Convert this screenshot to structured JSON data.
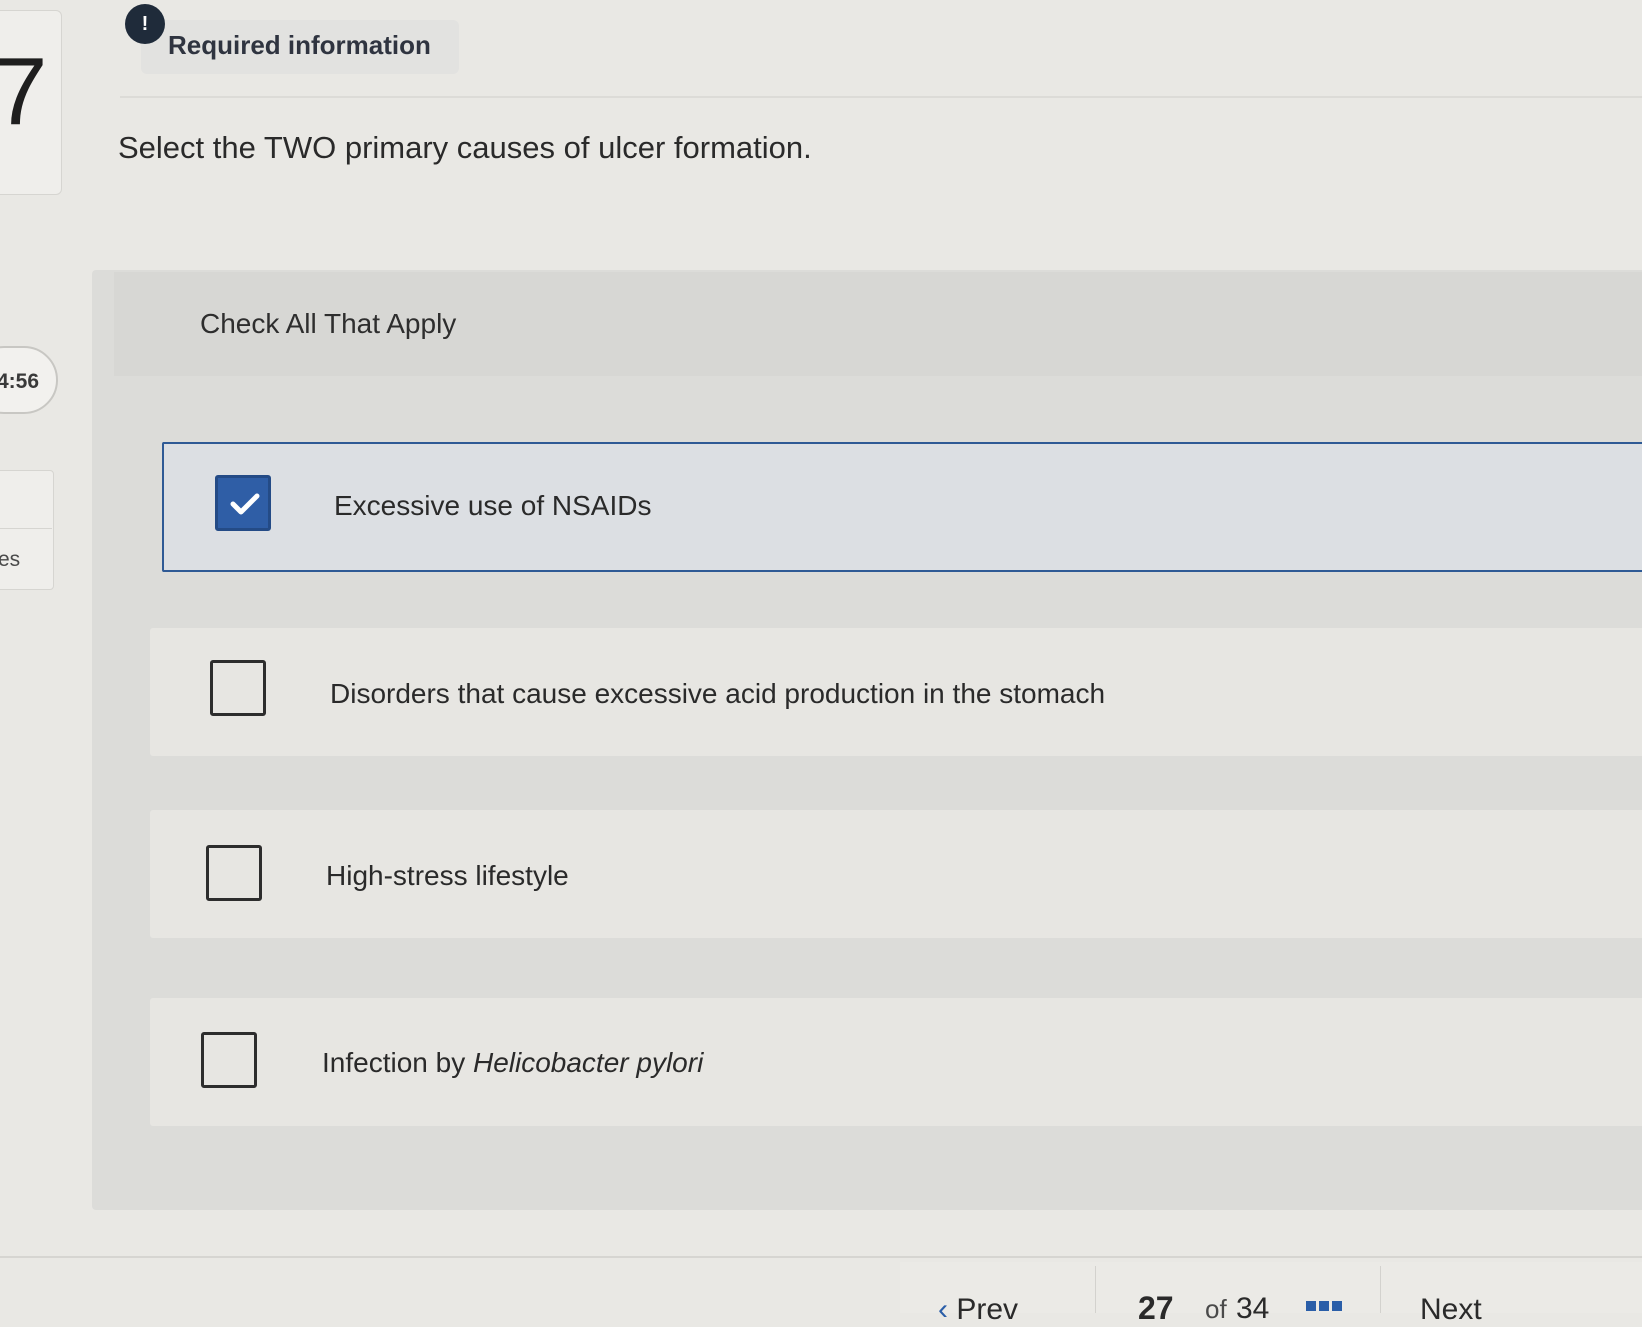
{
  "question": {
    "number": "7",
    "required_label": "Required information",
    "alert_icon": "exclamation",
    "prompt": "Select the TWO primary causes of ulcer formation.",
    "instruction": "Check All That Apply"
  },
  "sidebar": {
    "timer": "4:56",
    "partial_label": "es"
  },
  "options": [
    {
      "label": "Excessive use of NSAIDs",
      "checked": true
    },
    {
      "label": "Disorders that cause excessive acid production in the stomach",
      "checked": false
    },
    {
      "label": "High-stress lifestyle",
      "checked": false
    },
    {
      "label_prefix": "Infection by ",
      "label_italic": "Helicobacter pylori",
      "checked": false
    }
  ],
  "footer": {
    "prev_label": "Prev",
    "current_page": "27",
    "of_label": "of",
    "total_pages": "34",
    "next_label": "Next",
    "grid_icon": "grid-icon"
  },
  "colors": {
    "accent": "#2f5ea6",
    "selected_border": "#2f5a95",
    "alert_badge": "#1f2b3a"
  }
}
